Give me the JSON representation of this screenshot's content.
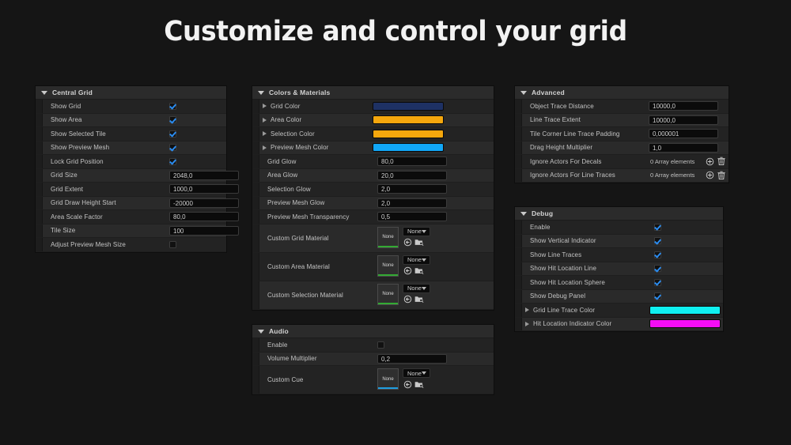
{
  "title": "Customize and control your grid",
  "panels": {
    "central_grid": {
      "header": "Central Grid",
      "rows": [
        {
          "label": "Show Grid",
          "type": "checkbox",
          "value": true
        },
        {
          "label": "Show Area",
          "type": "checkbox",
          "value": true
        },
        {
          "label": "Show Selected Tile",
          "type": "checkbox",
          "value": true
        },
        {
          "label": "Show Preview Mesh",
          "type": "checkbox",
          "value": true
        },
        {
          "label": "Lock Grid Position",
          "type": "checkbox",
          "value": true
        },
        {
          "label": "Grid Size",
          "type": "number",
          "value": "2048,0"
        },
        {
          "label": "Grid Extent",
          "type": "number",
          "value": "1000,0"
        },
        {
          "label": "Grid Draw Height Start",
          "type": "number",
          "value": "-20000"
        },
        {
          "label": "Area Scale Factor",
          "type": "number",
          "value": "80,0"
        },
        {
          "label": "Tile Size",
          "type": "number",
          "value": "100"
        },
        {
          "label": "Adjust Preview Mesh Size",
          "type": "checkbox",
          "value": false
        }
      ]
    },
    "colors_materials": {
      "header": "Colors & Materials",
      "rows": [
        {
          "label": "Grid Color",
          "type": "color",
          "value": "#1e3164",
          "expander": true
        },
        {
          "label": "Area Color",
          "type": "color",
          "value": "#f5a70d",
          "expander": true
        },
        {
          "label": "Selection Color",
          "type": "color",
          "value": "#f5a70d",
          "expander": true
        },
        {
          "label": "Preview Mesh Color",
          "type": "color",
          "value": "#11a7f7",
          "expander": true
        },
        {
          "label": "Grid Glow",
          "type": "number",
          "value": "80,0"
        },
        {
          "label": "Area Glow",
          "type": "number",
          "value": "20,0"
        },
        {
          "label": "Selection Glow",
          "type": "number",
          "value": "2,0"
        },
        {
          "label": "Preview Mesh Glow",
          "type": "number",
          "value": "2,0"
        },
        {
          "label": "Preview Mesh Transparency",
          "type": "number",
          "value": "0,5"
        },
        {
          "label": "Custom Grid Material",
          "type": "asset",
          "thumb_label": "None",
          "combo_value": "None",
          "accent": "#33aa33"
        },
        {
          "label": "Custom Area Material",
          "type": "asset",
          "thumb_label": "None",
          "combo_value": "None",
          "accent": "#33aa33"
        },
        {
          "label": "Custom Selection Material",
          "type": "asset",
          "thumb_label": "None",
          "combo_value": "None",
          "accent": "#33aa33"
        }
      ]
    },
    "audio": {
      "header": "Audio",
      "rows": [
        {
          "label": "Enable",
          "type": "checkbox",
          "value": false
        },
        {
          "label": "Volume Multiplier",
          "type": "number",
          "value": "0,2"
        },
        {
          "label": "Custom Cue",
          "type": "asset",
          "thumb_label": "None",
          "combo_value": "None",
          "accent": "#1f9de0"
        }
      ]
    },
    "advanced": {
      "header": "Advanced",
      "rows": [
        {
          "label": "Object Trace Distance",
          "type": "number",
          "value": "10000,0"
        },
        {
          "label": "Line Trace Extent",
          "type": "number",
          "value": "10000,0"
        },
        {
          "label": "Tile Corner Line Trace Padding",
          "type": "number",
          "value": "0,000001"
        },
        {
          "label": "Drag Height Multiplier",
          "type": "number",
          "value": "1,0"
        },
        {
          "label": "Ignore Actors For Decals",
          "type": "array",
          "value": "0 Array elements"
        },
        {
          "label": "Ignore Actors For Line Traces",
          "type": "array",
          "value": "0 Array elements"
        }
      ]
    },
    "debug": {
      "header": "Debug",
      "rows": [
        {
          "label": "Enable",
          "type": "checkbox",
          "value": true
        },
        {
          "label": "Show Vertical Indicator",
          "type": "checkbox",
          "value": true
        },
        {
          "label": "Show Line Traces",
          "type": "checkbox",
          "value": true
        },
        {
          "label": "Show Hit Location Line",
          "type": "checkbox",
          "value": true
        },
        {
          "label": "Show Hit Location Sphere",
          "type": "checkbox",
          "value": true
        },
        {
          "label": "Show Debug Panel",
          "type": "checkbox",
          "value": true
        },
        {
          "label": "Grid Line Trace Color",
          "type": "color",
          "value": "#0ff0f0",
          "expander": true
        },
        {
          "label": "Hit Location Indicator Color",
          "type": "color",
          "value": "#f50df5",
          "expander": true
        }
      ]
    }
  },
  "icons": {
    "use_selected": "use-selected-asset-icon",
    "browse": "browse-to-asset-icon",
    "add_element": "add-array-element-icon",
    "delete_all": "delete-array-icon"
  }
}
